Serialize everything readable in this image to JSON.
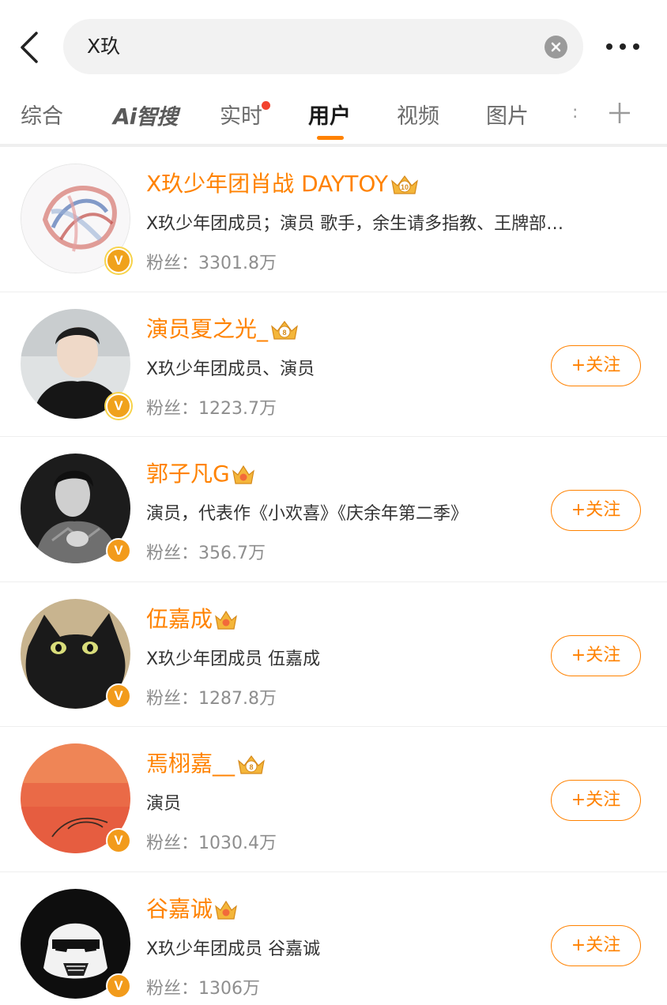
{
  "header": {
    "search_query": "X玖",
    "icons": {
      "back": "chevron-left-icon",
      "clear": "clear-circle-icon",
      "more": "more-dots-icon"
    }
  },
  "tabs": [
    {
      "label": "综合",
      "active": false
    },
    {
      "label": "AI智搜",
      "ai_prefix": "Ai",
      "ai_suffix": "智搜",
      "active": false
    },
    {
      "label": "实时",
      "active": false,
      "red_dot": true
    },
    {
      "label": "用户",
      "active": true
    },
    {
      "label": "视频",
      "active": false
    },
    {
      "label": "图片",
      "active": false
    }
  ],
  "tabs_overflow": ":",
  "colors": {
    "accent": "#ff8200",
    "verified_badge": "#f29b1b",
    "red_dot": "#f2422e"
  },
  "users": [
    {
      "name": "X玖少年团肖战 DAYTOY",
      "crown_level": "10",
      "desc": "X玖少年团成员；演员 歌手，余生请多指教、王牌部…",
      "fans_label": "粉丝：",
      "fans": "3301.8万",
      "badge": "V",
      "show_follow": false
    },
    {
      "name": "演员夏之光_",
      "crown_level": "8",
      "desc": "X玖少年团成员、演员",
      "fans_label": "粉丝：",
      "fans": "1223.7万",
      "badge": "V",
      "show_follow": true,
      "follow_label": "+关注"
    },
    {
      "name": "郭子凡G",
      "crown_level": "",
      "desc": "演员，代表作《小欢喜》《庆余年第二季》",
      "fans_label": "粉丝：",
      "fans": "356.7万",
      "badge": "V",
      "show_follow": true,
      "follow_label": "+关注"
    },
    {
      "name": "伍嘉成",
      "crown_level": "",
      "desc": "X玖少年团成员 伍嘉成",
      "fans_label": "粉丝：",
      "fans": "1287.8万",
      "badge": "V",
      "show_follow": true,
      "follow_label": "+关注"
    },
    {
      "name": "焉栩嘉__",
      "crown_level": "8",
      "desc": "演员",
      "fans_label": "粉丝：",
      "fans": "1030.4万",
      "badge": "V",
      "show_follow": true,
      "follow_label": "+关注"
    },
    {
      "name": "谷嘉诚",
      "crown_level": "",
      "desc": "X玖少年团成员 谷嘉诚",
      "fans_label": "粉丝：",
      "fans": "1306万",
      "badge": "V",
      "show_follow": true,
      "follow_label": "+关注"
    }
  ]
}
